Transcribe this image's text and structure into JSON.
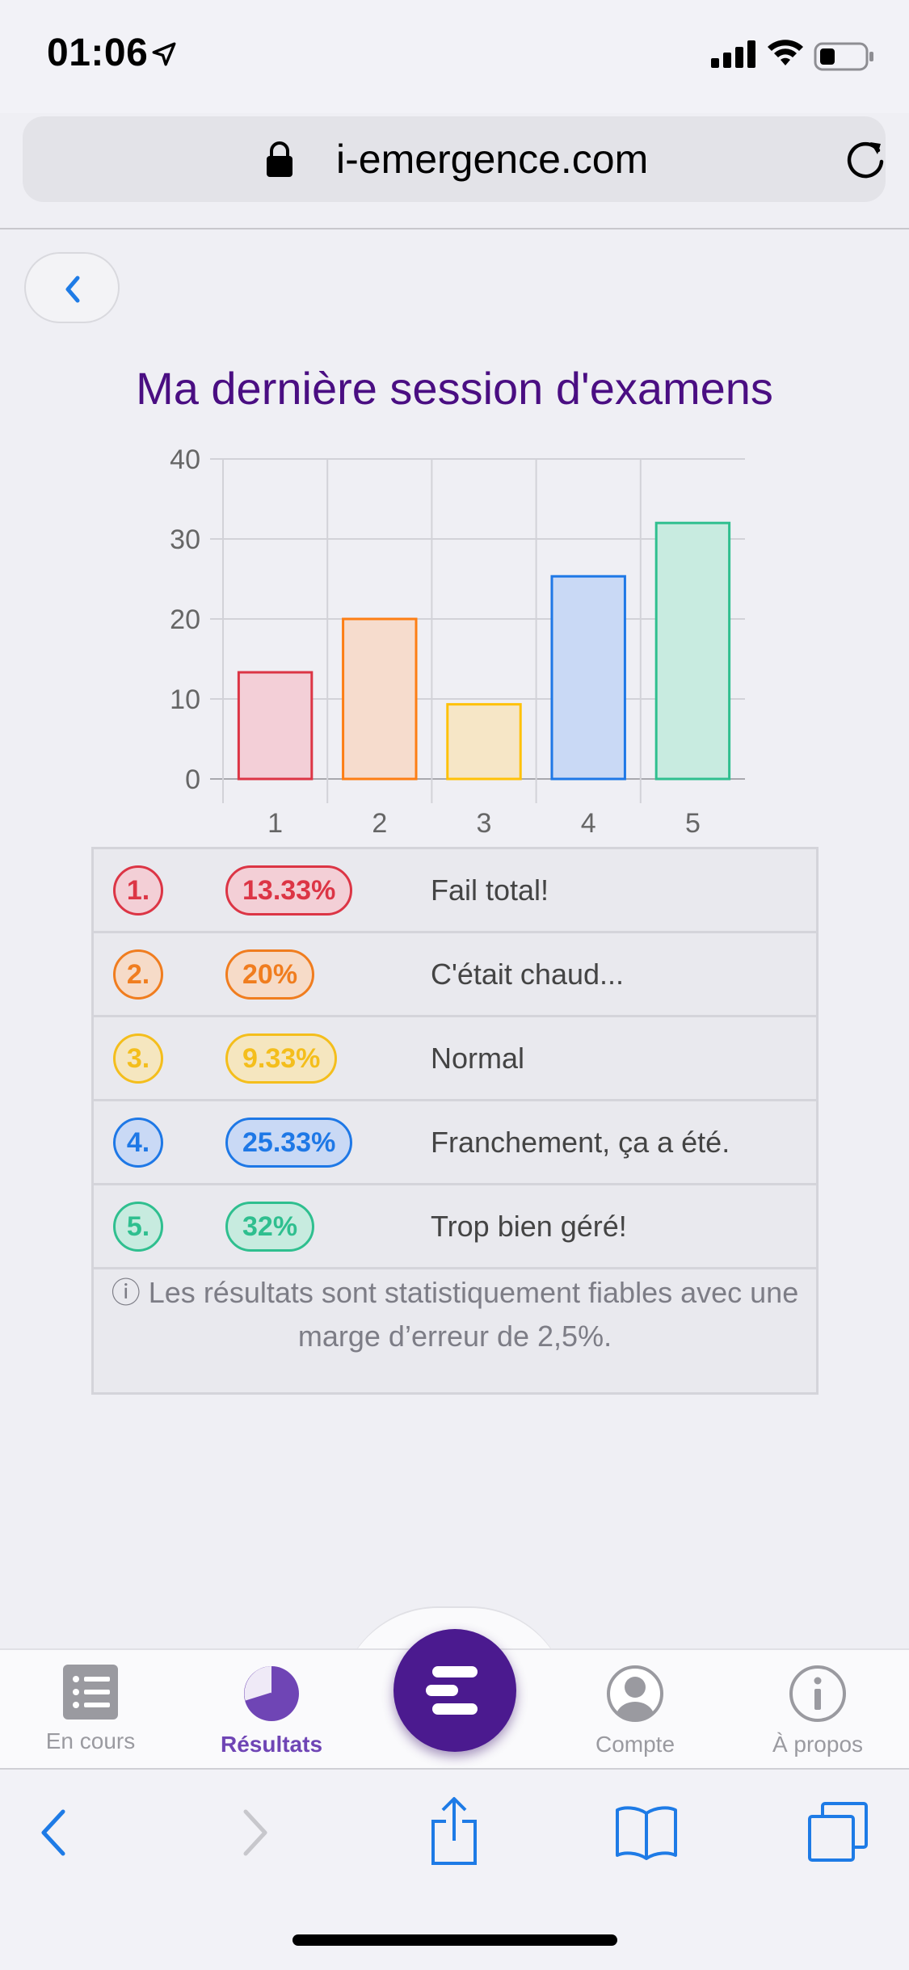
{
  "status_bar": {
    "time": "01:06"
  },
  "browser": {
    "url": "i-emergence.com"
  },
  "page": {
    "title": "Ma dernière session d'examens"
  },
  "chart_data": {
    "type": "bar",
    "categories": [
      "1",
      "2",
      "3",
      "4",
      "5"
    ],
    "values": [
      13.33,
      20,
      9.33,
      25.33,
      32
    ],
    "ylim": [
      0,
      40
    ],
    "yticks": [
      "0",
      "10",
      "20",
      "30",
      "40"
    ],
    "grid": true,
    "title": "",
    "xlabel": "",
    "ylabel": "",
    "colors": [
      "#dc3545",
      "#fd7e14",
      "#ffc107",
      "#1e78e6",
      "#2fbf8f"
    ],
    "fills": [
      "#f3cfd7",
      "#f6dccd",
      "#f6e6c6",
      "#c9d9f5",
      "#c8ebe0"
    ]
  },
  "results": [
    {
      "num": "1.",
      "pct": "13.33%",
      "label": "Fail total!",
      "color": "#dc3545",
      "bg": "#f3cfd6"
    },
    {
      "num": "2.",
      "pct": "20%",
      "label": "C'était chaud...",
      "color": "#f07d1f",
      "bg": "#f6dbc8"
    },
    {
      "num": "3.",
      "pct": "9.33%",
      "label": "Normal",
      "color": "#f4be1c",
      "bg": "#f5e6bf"
    },
    {
      "num": "4.",
      "pct": "25.33%",
      "label": "Franchement, ça a été.",
      "color": "#1e78e6",
      "bg": "#c9d9f5"
    },
    {
      "num": "5.",
      "pct": "32%",
      "label": "Trop bien géré!",
      "color": "#2fbf8f",
      "bg": "#c7ebdf"
    }
  ],
  "note": {
    "text": "ⓘ Les résultats sont statistiquement fiables avec une marge d’erreur de 2,5%."
  },
  "nav": {
    "en_cours": "En cours",
    "resultats": "Résultats",
    "compte": "Compte",
    "a_propos": "À propos",
    "active_color": "#6f45b5",
    "inactive_color": "#9a9aa0"
  },
  "icons": {
    "location": "location-arrow-icon",
    "lock": "lock-icon",
    "reload": "reload-icon",
    "back": "chevron-left-icon",
    "list": "list-icon",
    "pie": "pie-chart-icon",
    "logo": "app-logo-icon",
    "user": "user-icon",
    "info": "info-icon",
    "share": "share-icon",
    "bookmarks": "book-icon",
    "tabs": "tabs-icon"
  }
}
